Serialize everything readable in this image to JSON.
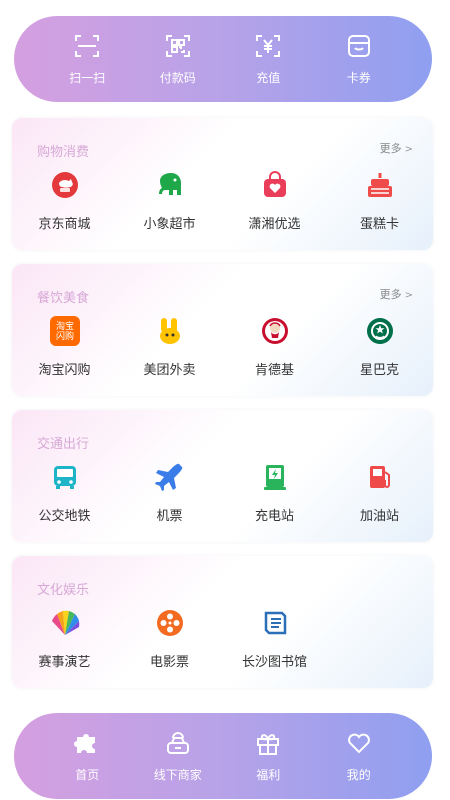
{
  "top_bar": {
    "items": [
      {
        "label": "扫一扫",
        "icon": "scan-icon"
      },
      {
        "label": "付款码",
        "icon": "qr-code-icon"
      },
      {
        "label": "充值",
        "icon": "yen-recharge-icon"
      },
      {
        "label": "卡券",
        "icon": "coupon-card-icon"
      }
    ]
  },
  "sections": [
    {
      "title": "购物消费",
      "more": "更多",
      "items": [
        {
          "label": "京东商城",
          "icon": "jd-mall-icon"
        },
        {
          "label": "小象超市",
          "icon": "elephant-supermarket-icon"
        },
        {
          "label": "潇湘优选",
          "icon": "shopping-bag-heart-icon"
        },
        {
          "label": "蛋糕卡",
          "icon": "cake-icon"
        }
      ]
    },
    {
      "title": "餐饮美食",
      "more": "更多",
      "items": [
        {
          "label": "淘宝闪购",
          "icon": "taobao-flash-icon",
          "icon_text": [
            "淘宝",
            "闪购"
          ]
        },
        {
          "label": "美团外卖",
          "icon": "meituan-kangaroo-icon"
        },
        {
          "label": "肯德基",
          "icon": "kfc-icon"
        },
        {
          "label": "星巴克",
          "icon": "starbucks-icon"
        }
      ]
    },
    {
      "title": "交通出行",
      "items": [
        {
          "label": "公交地铁",
          "icon": "bus-icon"
        },
        {
          "label": "机票",
          "icon": "airplane-icon"
        },
        {
          "label": "充电站",
          "icon": "charging-station-icon"
        },
        {
          "label": "加油站",
          "icon": "gas-station-icon"
        }
      ]
    },
    {
      "title": "文化娱乐",
      "items": [
        {
          "label": "赛事演艺",
          "icon": "fan-performance-icon"
        },
        {
          "label": "电影票",
          "icon": "film-reel-icon"
        },
        {
          "label": "长沙图书馆",
          "icon": "library-book-icon"
        }
      ]
    }
  ],
  "bottom_nav": {
    "items": [
      {
        "label": "首页",
        "icon": "puzzle-home-icon",
        "active": true
      },
      {
        "label": "线下商家",
        "icon": "store-icon"
      },
      {
        "label": "福利",
        "icon": "gift-icon"
      },
      {
        "label": "我的",
        "icon": "heart-icon"
      }
    ]
  },
  "colors": {
    "pill_gradient": [
      "#d59fe0",
      "#b7a2e8",
      "#8f9ff0"
    ],
    "section_title": "#d6a8d6",
    "jd_red": "#e4393c",
    "elephant_green": "#1fa84a",
    "bag_red": "#ea3d5a",
    "cake_red": "#ef4b4b",
    "taobao_orange": "#ff6a00",
    "meituan_yellow": "#ffc300",
    "kfc_red": "#c8102e",
    "starbucks_green": "#00704a",
    "transit_teal": "#1eb4c8",
    "plane_blue": "#3a7ce8",
    "charge_green": "#29b45c",
    "gas_red": "#ee4a4a",
    "film_orange": "#f26b21",
    "library_blue": "#2b6fb8"
  }
}
